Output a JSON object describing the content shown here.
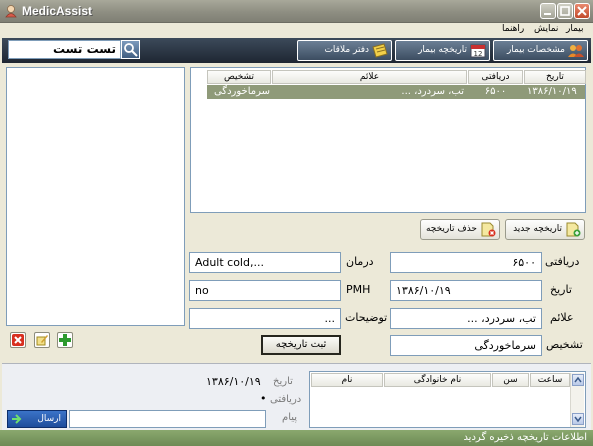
{
  "window": {
    "title": "MedicAssist"
  },
  "menu": {
    "items": [
      "بیمار",
      "نمایش",
      "راهنما"
    ]
  },
  "toolbar": {
    "search_value": "تست تست",
    "buttons": {
      "patient_info": "مشخصات بیمار",
      "patient_history": "تاریخچه بیمار",
      "appointments": "دفتر ملاقات"
    }
  },
  "history_table": {
    "columns": [
      "تاریخ",
      "دریافتی",
      "علائم",
      "تشخیص"
    ],
    "rows": [
      {
        "date": "۱۳۸۶/۱۰/۱۹",
        "received": "۶۵۰۰",
        "symptoms": "تب، سردرد، ...",
        "diagnosis": "سرماخوردگی"
      }
    ]
  },
  "actions": {
    "new_history": "تاریخچه جدید",
    "delete_history": "حذف تاریخچه"
  },
  "form": {
    "received_label": "دریافتی",
    "received_value": "۶۵۰۰",
    "treatment_label": "درمان",
    "treatment_value": "Adult cold,...",
    "date_label": "تاریخ",
    "date_value": "۱۳۸۶/۱۰/۱۹",
    "pmh_label": "PMH",
    "pmh_value": "no",
    "symptoms_label": "علائم",
    "symptoms_value": "تب، سردرد، ...",
    "notes_label": "توضیحات",
    "notes_value": "...",
    "diagnosis_label": "تشخیص",
    "diagnosis_value": "سرماخوردگی",
    "submit_label": "ثبت تاریخچه"
  },
  "summary": {
    "date_label": "تاریخ",
    "date_value": "۱۳۸۶/۱۰/۱۹",
    "received_label": "دریافتی",
    "received_value": "•",
    "message_label": "پیام",
    "send_label": "ارسال"
  },
  "appointments_table": {
    "columns": [
      "ساعت",
      "سن",
      "نام خانوادگی",
      "نام"
    ]
  },
  "status": {
    "text": "اطلاعات تاریخچه ذخیره گردید"
  },
  "colors": {
    "toolbar_bg": "#2a3442",
    "selected_row": "#8f9a79",
    "statusbar": "#7a9862"
  }
}
